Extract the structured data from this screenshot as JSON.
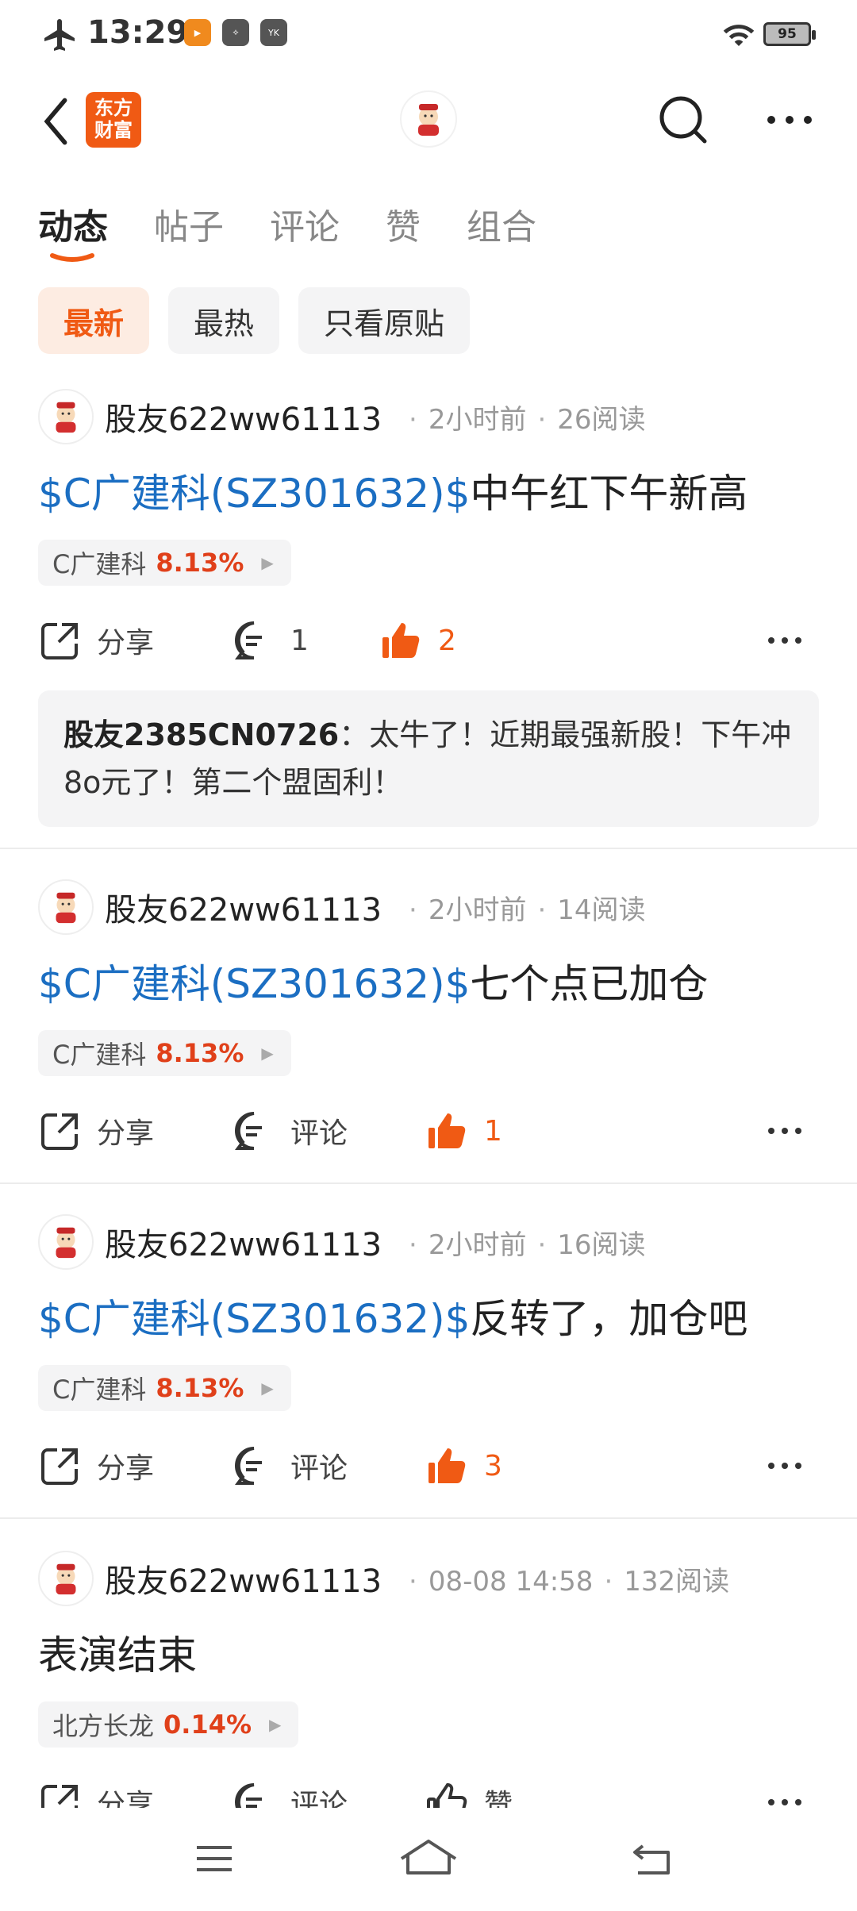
{
  "status_bar": {
    "time": "13:29",
    "battery": "95"
  },
  "header": {
    "logo_text_line1": "东方",
    "logo_text_line2": "财富"
  },
  "tabs": [
    {
      "label": "动态",
      "active": true
    },
    {
      "label": "帖子",
      "active": false
    },
    {
      "label": "评论",
      "active": false
    },
    {
      "label": "赞",
      "active": false
    },
    {
      "label": "组合",
      "active": false
    }
  ],
  "filters": [
    {
      "label": "最新",
      "active": true
    },
    {
      "label": "最热",
      "active": false
    },
    {
      "label": "只看原贴",
      "active": false
    }
  ],
  "posts": [
    {
      "user": "股友622ww61113",
      "time": "2小时前",
      "reads": "26阅读",
      "stock_link": "$C广建科(SZ301632)$",
      "text": "中午红下午新高",
      "tag_name": "C广建科",
      "tag_pct": "8.13%",
      "share": "分享",
      "comment": "1",
      "like": "2",
      "reply_user": "股友2385CN0726",
      "reply_text": "：太牛了！近期最强新股！下午冲8o元了！第二个盟固利！"
    },
    {
      "user": "股友622ww61113",
      "time": "2小时前",
      "reads": "14阅读",
      "stock_link": "$C广建科(SZ301632)$",
      "text": "七个点已加仓",
      "tag_name": "C广建科",
      "tag_pct": "8.13%",
      "share": "分享",
      "comment": "评论",
      "like": "1"
    },
    {
      "user": "股友622ww61113",
      "time": "2小时前",
      "reads": "16阅读",
      "stock_link": "$C广建科(SZ301632)$",
      "text": "反转了，加仓吧",
      "tag_name": "C广建科",
      "tag_pct": "8.13%",
      "share": "分享",
      "comment": "评论",
      "like": "3"
    },
    {
      "user": "股友622ww61113",
      "time": "08-08 14:58",
      "reads": "132阅读",
      "stock_link": "",
      "text": "表演结束",
      "tag_name": "北方长龙",
      "tag_pct": "0.14%",
      "share": "分享",
      "comment": "评论",
      "like": "赞"
    }
  ],
  "colors": {
    "accent": "#f05a14",
    "link": "#1b6ec2",
    "up": "#e0401a"
  }
}
